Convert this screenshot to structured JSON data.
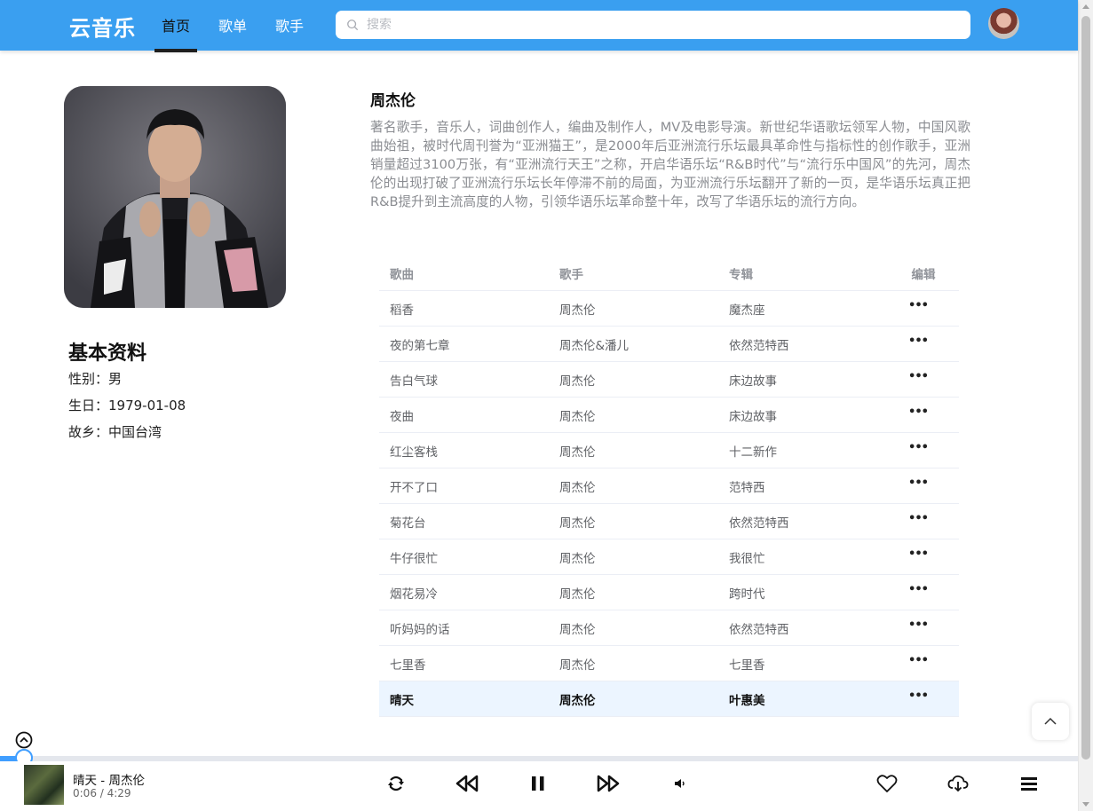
{
  "header": {
    "logo": "云音乐",
    "nav": [
      "首页",
      "歌单",
      "歌手"
    ],
    "search_placeholder": "搜索"
  },
  "artist": {
    "name": "周杰伦",
    "description": "著名歌手，音乐人，词曲创作人，编曲及制作人，MV及电影导演。新世纪华语歌坛领军人物，中国风歌曲始祖，被时代周刊誉为“亚洲猫王”，是2000年后亚洲流行乐坛最具革命性与指标性的创作歌手，亚洲销量超过3100万张，有“亚洲流行天王”之称，开启华语乐坛“R&B时代”与“流行乐中国风”的先河，周杰伦的出现打破了亚洲流行乐坛长年停滞不前的局面，为亚洲流行乐坛翻开了新的一页，是华语乐坛真正把R&B提升到主流高度的人物，引领华语乐坛革命整十年，改写了华语乐坛的流行方向。",
    "info_title": "基本资料",
    "gender": "性别：男",
    "birthday": "生日：1979-01-08",
    "hometown": "故乡：中国台湾"
  },
  "table": {
    "headers": [
      "歌曲",
      "歌手",
      "专辑",
      "编辑"
    ],
    "rows": [
      {
        "song": "稻香",
        "singer": "周杰伦",
        "album": "魔杰座"
      },
      {
        "song": "夜的第七章",
        "singer": "周杰伦&潘儿",
        "album": "依然范特西"
      },
      {
        "song": "告白气球",
        "singer": "周杰伦",
        "album": "床边故事"
      },
      {
        "song": "夜曲",
        "singer": "周杰伦",
        "album": "床边故事"
      },
      {
        "song": "红尘客栈",
        "singer": "周杰伦",
        "album": "十二新作"
      },
      {
        "song": "开不了口",
        "singer": "周杰伦",
        "album": "范特西"
      },
      {
        "song": "菊花台",
        "singer": "周杰伦",
        "album": "依然范特西"
      },
      {
        "song": "牛仔很忙",
        "singer": "周杰伦",
        "album": "我很忙"
      },
      {
        "song": "烟花易冷",
        "singer": "周杰伦",
        "album": "跨时代"
      },
      {
        "song": "听妈妈的话",
        "singer": "周杰伦",
        "album": "依然范特西"
      },
      {
        "song": "七里香",
        "singer": "周杰伦",
        "album": "七里香"
      },
      {
        "song": "晴天",
        "singer": "周杰伦",
        "album": "叶惠美"
      }
    ],
    "current_index": 11,
    "more_symbol": "•••"
  },
  "player": {
    "title": "晴天 - 周杰伦",
    "time": "0:06 / 4:29",
    "progress": 0.022
  },
  "colors": {
    "header": "#3a9ff0",
    "accent": "#409eff",
    "current_row": "#ecf5ff"
  }
}
